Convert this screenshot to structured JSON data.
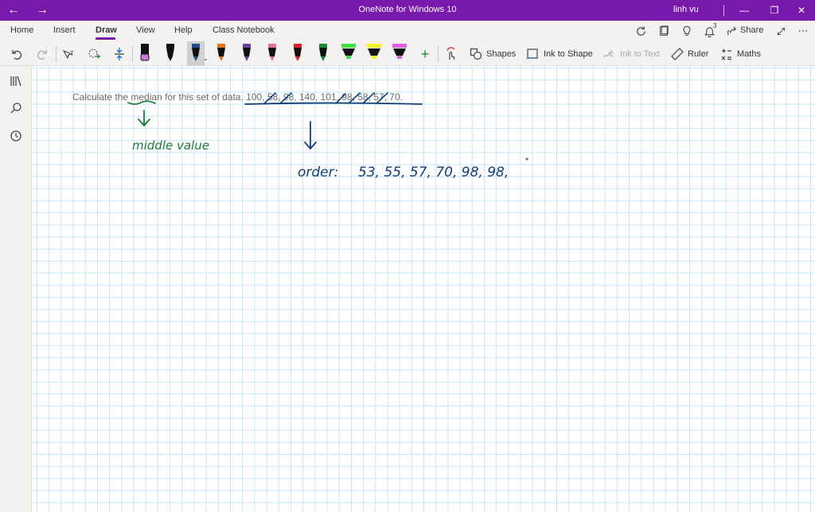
{
  "titlebar": {
    "title": "OneNote for Windows 10",
    "user": "linh vu",
    "back_icon": "back-arrow-icon",
    "forward_icon": "forward-arrow-icon"
  },
  "tabs": [
    {
      "label": "Home"
    },
    {
      "label": "Insert"
    },
    {
      "label": "Draw"
    },
    {
      "label": "View"
    },
    {
      "label": "Help"
    },
    {
      "label": "Class Notebook"
    }
  ],
  "active_tab": "Draw",
  "ribbon_right": {
    "notifications_count": "3",
    "share_label": "Share"
  },
  "toolbar": {
    "shapes_label": "Shapes",
    "ink_to_shape_label": "Ink to Shape",
    "ink_to_text_label": "Ink to Text",
    "ruler_label": "Ruler",
    "maths_label": "Maths",
    "pens": [
      {
        "type": "pen",
        "color": "#c87ad6"
      },
      {
        "type": "pen",
        "color": "#111111"
      },
      {
        "type": "pen",
        "color": "#1b4f8a",
        "selected": true
      },
      {
        "type": "pen",
        "color": "#e8731a"
      },
      {
        "type": "pen",
        "color": "#6b3fa0"
      },
      {
        "type": "pen",
        "color": "#e86fa0"
      },
      {
        "type": "pen",
        "color": "#e02020"
      },
      {
        "type": "pen",
        "color": "#1a8a3a"
      },
      {
        "type": "highlighter",
        "color": "#3ee03e"
      },
      {
        "type": "highlighter",
        "color": "#f5f520"
      },
      {
        "type": "highlighter",
        "color": "#e060e0"
      }
    ]
  },
  "page": {
    "question_prefix": "Calculate the ",
    "question_median": "median",
    "question_suffix": " for this set of data. ",
    "question_data": "100, 58, 98, 140, 101, 98, 58, 57, 70.",
    "ink_median_note": "middle value",
    "ink_order_label": "order:",
    "ink_order_values": "53, 55, 57, 70, 98, 98,"
  }
}
